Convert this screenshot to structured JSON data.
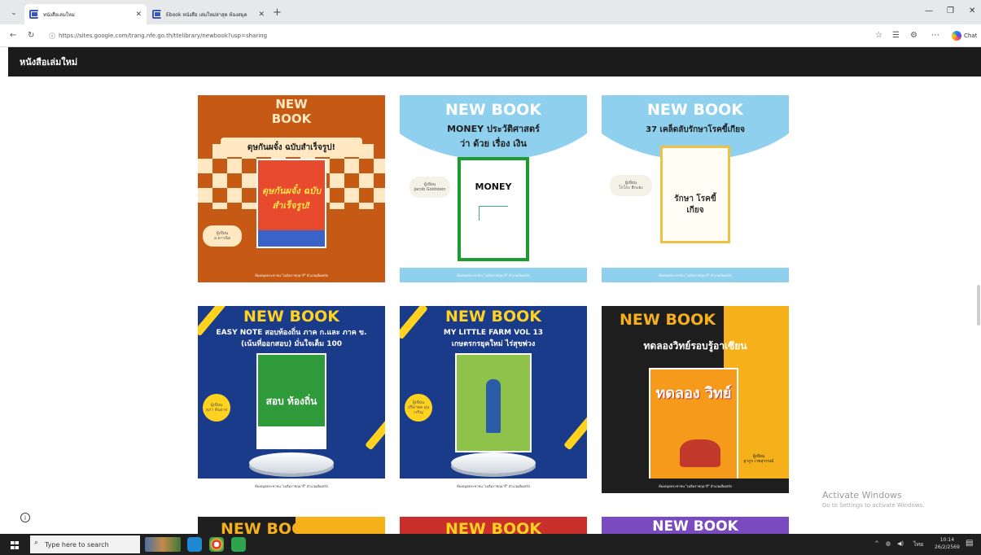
{
  "browser": {
    "tabs": [
      {
        "label": "หนังสือเล่มใหม่",
        "active": true
      },
      {
        "label": "Ebook หนังสือ เล่มใหม่ล่าสุด ห้องสมุด",
        "active": false
      }
    ],
    "url": "https://sites.google.com/trang.nfe.go.th/ttelibrary/newbook?usp=sharing",
    "chat_label": "Chat"
  },
  "site": {
    "header_title": "หนังสือเล่มใหม่"
  },
  "cards": [
    {
      "banner": "NEW\nBOOK",
      "title": "ดุษกันผจั๋ง ฉบับสำเร็จรูป!",
      "book_text": "ดุษกันผจั๋ง ฉบับ สำเร็จรูป!",
      "pill": "ผู้เขียน\nอ.ดาวนิล",
      "footer": "ห้องสมุดประชาชน \"เฉลิมราชกุมารี\" อำเภอเมืองตรัง",
      "colors": {
        "bg": "#c65a14",
        "accent": "#ffe8c2"
      }
    },
    {
      "banner": "NEW BOOK",
      "title": "MONEY ประวัติศาสตร์\nว่า ด้วย เรื่อง เงิน",
      "book_text": "MONEY",
      "pill": "ผู้เขียน\nJacob Goldstein",
      "footer": "ห้องสมุดประชาชน \"เฉลิมราชกุมารี\" อำเภอเมืองตรัง",
      "colors": {
        "bg": "#8fd0ef",
        "accent": "#1b9b30"
      }
    },
    {
      "banner": "NEW BOOK",
      "title": "37 เคล็ดลับรักษาโรคขี้เกียจ",
      "book_text": "รักษา โรคขี้เกียจ",
      "pill": "ผู้เขียน\nโกโกะ ฮิกะยะ",
      "footer": "ห้องสมุดประชาชน \"เฉลิมราชกุมารี\" อำเภอเมืองตรัง",
      "colors": {
        "bg": "#8fd0ef",
        "accent": "#f0c040"
      }
    },
    {
      "banner": "NEW BOOK",
      "title": "EASY NOTE สอบท้องถิ่น ภาค ก.และ ภาค ข.\n(เน้นที่ออกสอบ) มั่นใจเต็ม 100",
      "book_text": "สอบ ท้องถิ่น",
      "pill": "ผู้เขียน\nสุภา ต้นอาจ",
      "footer": "ห้องสมุดประชาชน \"เฉลิมราชกุมารี\" อำเภอเมืองตรัง",
      "colors": {
        "bg": "#1a3a8a",
        "accent": "#ffd21f"
      }
    },
    {
      "banner": "NEW BOOK",
      "title": "MY LITTLE FARM VOL 13\nเกษตรกรยุคใหม่ ไร่สุขพ่วง",
      "book_text": "",
      "pill": "ผู้เขียน\nปรีดาพล อุ่นเจริญ",
      "footer": "ห้องสมุดประชาชน \"เฉลิมราชกุมารี\" อำเภอเมืองตรัง",
      "colors": {
        "bg": "#1a3a8a",
        "accent": "#ffd21f"
      }
    },
    {
      "banner": "NEW BOOK",
      "title": "ทดลองวิทย์รอบรู้อาเซียน",
      "book_text": "ทดลอง วิทย์",
      "pill": "ผู้เขียน\nฐากูร เวชสุวรรณ์",
      "footer": "ห้องสมุดประชาชน \"เฉลิมราชกุมารี\" อำเภอเมืองตรัง",
      "colors": {
        "bg": "#1e1e1e",
        "accent": "#f5b01a"
      }
    },
    {
      "banner": "NEW BOOK",
      "colors": {
        "bg": "#1e1e1e",
        "accent": "#f5b01a"
      }
    },
    {
      "banner": "NEW BOOK",
      "colors": {
        "bg": "#c9302c",
        "accent": "#ffd21f"
      }
    },
    {
      "banner": "NEW BOOK",
      "colors": {
        "bg": "#7a4bc0",
        "accent": "#ffffff"
      }
    }
  ],
  "taskbar": {
    "search_placeholder": "Type here to search",
    "time": "10:14",
    "date": "26/2/2569",
    "lang": "ไทย"
  },
  "watermark": {
    "line1": "Activate Windows",
    "line2": "Go to Settings to activate Windows."
  }
}
